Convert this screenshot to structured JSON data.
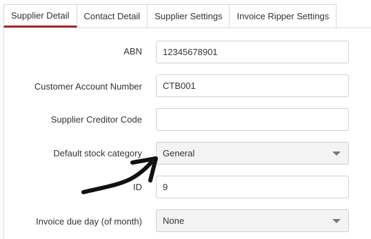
{
  "tabs": [
    {
      "label": "Supplier Detail",
      "active": true
    },
    {
      "label": "Contact Detail",
      "active": false
    },
    {
      "label": "Supplier Settings",
      "active": false
    },
    {
      "label": "Invoice Ripper Settings",
      "active": false
    }
  ],
  "form": {
    "abn": {
      "label": "ABN",
      "value": "12345678901"
    },
    "customer_account_number": {
      "label": "Customer Account Number",
      "value": "CTB001"
    },
    "supplier_creditor_code": {
      "label": "Supplier Creditor Code",
      "value": ""
    },
    "default_stock_category": {
      "label": "Default stock category",
      "value": "General"
    },
    "id": {
      "label": "ID",
      "value": "9"
    },
    "invoice_due_day": {
      "label": "Invoice due day (of month)",
      "value": "None"
    }
  },
  "annotation": {
    "icon": "hand-drawn-arrow-icon",
    "color": "#111111"
  },
  "colors": {
    "active_tab_underline": "#a3292c"
  }
}
